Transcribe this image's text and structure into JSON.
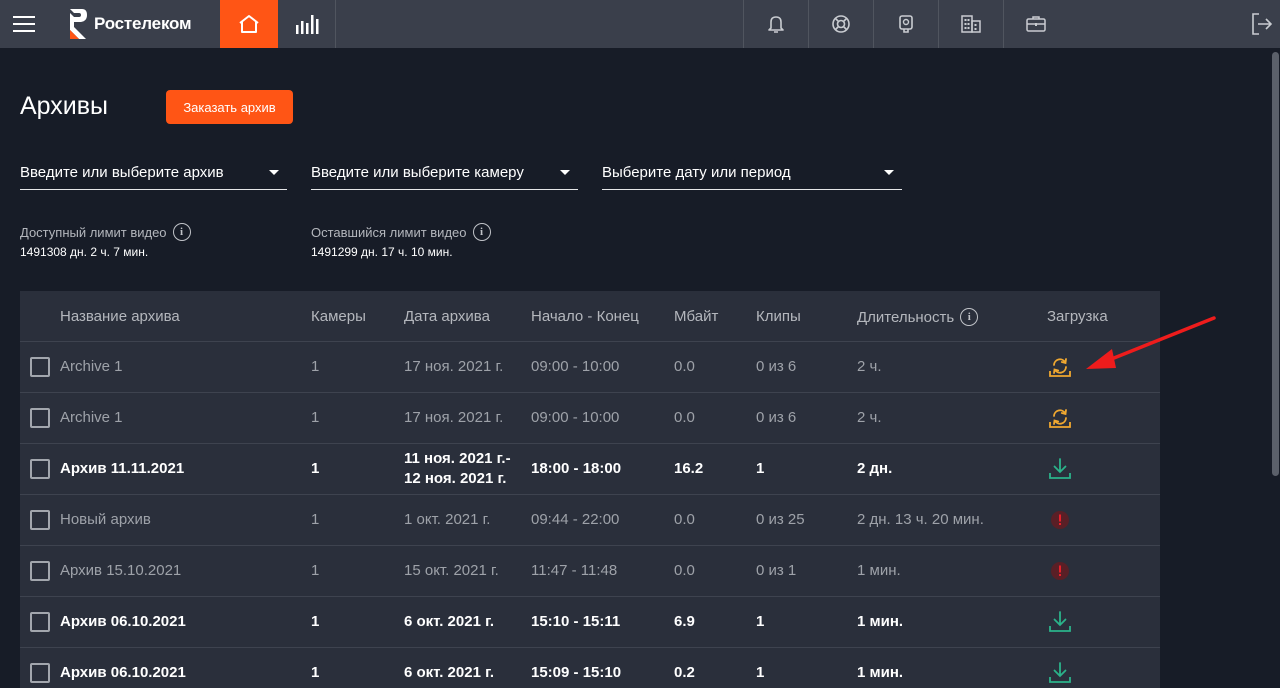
{
  "header": {
    "logo_text": "Ростелеком",
    "icons": [
      "menu-icon",
      "home-icon",
      "stats-icon",
      "bell-icon",
      "support-icon",
      "camera-icon",
      "building-icon",
      "briefcase-icon",
      "logout-icon"
    ],
    "accent": "#ff5515"
  },
  "page": {
    "title": "Архивы",
    "order_button": "Заказать архив"
  },
  "filters": {
    "archive": "Введите или выберите архив",
    "camera": "Введите или выберите камеру",
    "date": "Выберите дату или период"
  },
  "limits": {
    "available_label": "Доступный лимит видео",
    "available_value": "1491308 дн. 2 ч. 7 мин.",
    "remaining_label": "Оставшийся лимит видео",
    "remaining_value": "1491299 дн. 17 ч. 10 мин."
  },
  "table": {
    "headers": {
      "name": "Название архива",
      "cameras": "Камеры",
      "date": "Дата архива",
      "range": "Начало - Конец",
      "mb": "Мбайт",
      "clips": "Клипы",
      "duration": "Длительность",
      "download": "Загрузка"
    },
    "rows": [
      {
        "name": "Archive 1",
        "cameras": "1",
        "date": "17 ноя. 2021 г.",
        "date2": "",
        "range": "09:00 - 10:00",
        "mb": "0.0",
        "clips": "0 из 6",
        "duration": "2 ч.",
        "status": "processing",
        "style": "muted"
      },
      {
        "name": "Archive 1",
        "cameras": "1",
        "date": "17 ноя. 2021 г.",
        "date2": "",
        "range": "09:00 - 10:00",
        "mb": "0.0",
        "clips": "0 из 6",
        "duration": "2 ч.",
        "status": "processing",
        "style": "muted"
      },
      {
        "name": "Архив 11.11.2021",
        "cameras": "1",
        "date": "11 ноя. 2021 г.-",
        "date2": "12 ноя. 2021 г.",
        "range": "18:00 - 18:00",
        "mb": "16.2",
        "clips": "1",
        "duration": "2 дн.",
        "status": "download",
        "style": "bold"
      },
      {
        "name": "Новый архив",
        "cameras": "1",
        "date": "1 окт. 2021 г.",
        "date2": "",
        "range": "09:44 - 22:00",
        "mb": "0.0",
        "clips": "0 из 25",
        "duration": "2 дн. 13 ч. 20 мин.",
        "status": "error",
        "style": "muted"
      },
      {
        "name": "Архив 15.10.2021",
        "cameras": "1",
        "date": "15 окт. 2021 г.",
        "date2": "",
        "range": "11:47 - 11:48",
        "mb": "0.0",
        "clips": "0 из 1",
        "duration": "1 мин.",
        "status": "error",
        "style": "muted"
      },
      {
        "name": "Архив 06.10.2021",
        "cameras": "1",
        "date": "6 окт. 2021 г.",
        "date2": "",
        "range": "15:10 - 15:11",
        "mb": "6.9",
        "clips": "1",
        "duration": "1 мин.",
        "status": "download",
        "style": "bold"
      },
      {
        "name": "Архив 06.10.2021",
        "cameras": "1",
        "date": "6 окт. 2021 г.",
        "date2": "",
        "range": "15:09 - 15:10",
        "mb": "0.2",
        "clips": "1",
        "duration": "1 мин.",
        "status": "download",
        "style": "bold"
      }
    ]
  },
  "colors": {
    "processing": "#f0a830",
    "download": "#2bb38a",
    "error": "#e8202a",
    "annotation_arrow": "#ee1c1c"
  }
}
